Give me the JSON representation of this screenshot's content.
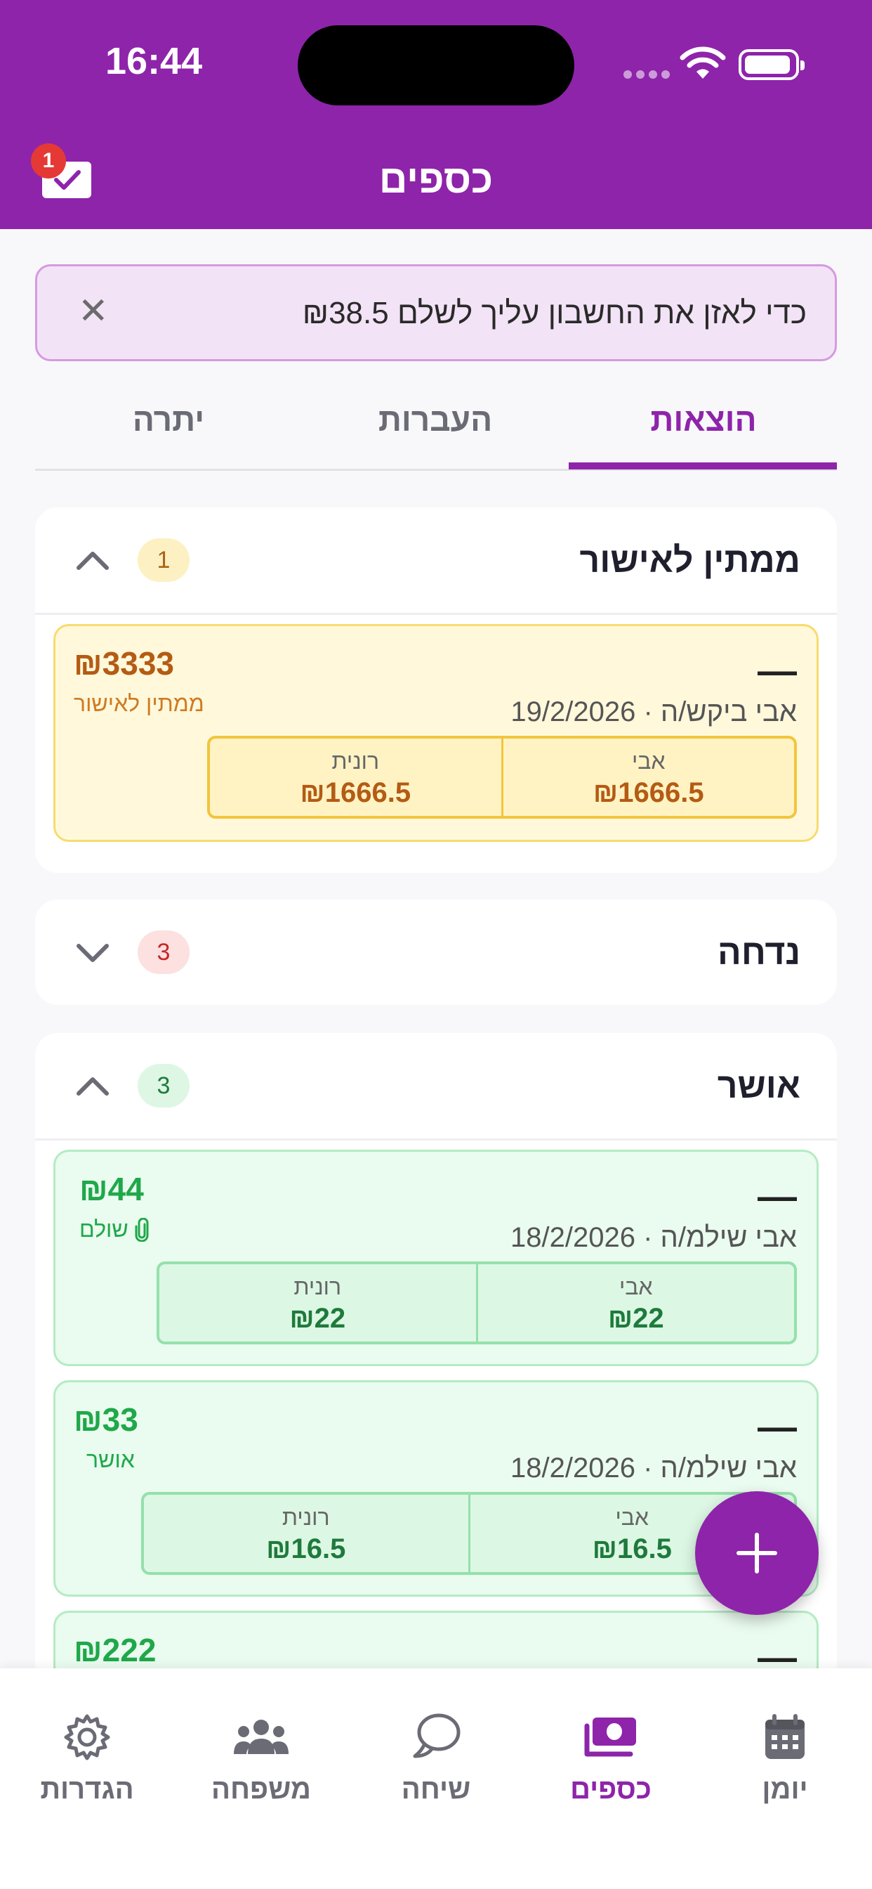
{
  "status_bar": {
    "time": "16:44"
  },
  "header": {
    "title": "כספים",
    "mail_badge": "1"
  },
  "banner": {
    "text": "כדי לאזן את החשבון עליך לשלם ₪38.5",
    "close": "✕"
  },
  "tabs": [
    {
      "label": "הוצאות",
      "active": true
    },
    {
      "label": "העברות",
      "active": false
    },
    {
      "label": "יתרה",
      "active": false
    }
  ],
  "sections": {
    "pending": {
      "title": "ממתין לאישור",
      "count": "1",
      "expanded": true,
      "cards": [
        {
          "dash": "—",
          "subtitle": "אבי ביקש/ה · 19/2/2026",
          "amount": "₪3333",
          "status": "ממתין לאישור",
          "splits": [
            {
              "name": "אבי",
              "amount": "₪1666.5"
            },
            {
              "name": "רונית",
              "amount": "₪1666.5"
            }
          ]
        }
      ]
    },
    "rejected": {
      "title": "נדחה",
      "count": "3",
      "expanded": false
    },
    "approved": {
      "title": "אושר",
      "count": "3",
      "expanded": true,
      "cards": [
        {
          "dash": "—",
          "subtitle": "אבי שילמ/ה · 18/2/2026",
          "amount": "₪44",
          "status": "שולם",
          "attachment_icon": "paperclip-icon",
          "splits": [
            {
              "name": "אבי",
              "amount": "₪22"
            },
            {
              "name": "רונית",
              "amount": "₪22"
            }
          ]
        },
        {
          "dash": "—",
          "subtitle": "אבי שילמ/ה · 18/2/2026",
          "amount": "₪33",
          "status": "אושר",
          "splits": [
            {
              "name": "אבי",
              "amount": "₪16.5"
            },
            {
              "name": "רונית",
              "amount": "₪16.5"
            }
          ]
        },
        {
          "dash": "—",
          "amount": "₪222"
        }
      ]
    }
  },
  "bottom_nav": [
    {
      "label": "יומן",
      "icon": "calendar-icon",
      "active": false
    },
    {
      "label": "כספים",
      "icon": "money-icon",
      "active": true
    },
    {
      "label": "שיחה",
      "icon": "chat-icon",
      "active": false
    },
    {
      "label": "משפחה",
      "icon": "family-icon",
      "active": false
    },
    {
      "label": "הגדרות",
      "icon": "gear-icon",
      "active": false
    }
  ],
  "colors": {
    "brand": "#8e24aa",
    "pending_amount": "#b45b14",
    "approved_amount": "#1fa84a",
    "alert_badge": "#e53935"
  }
}
